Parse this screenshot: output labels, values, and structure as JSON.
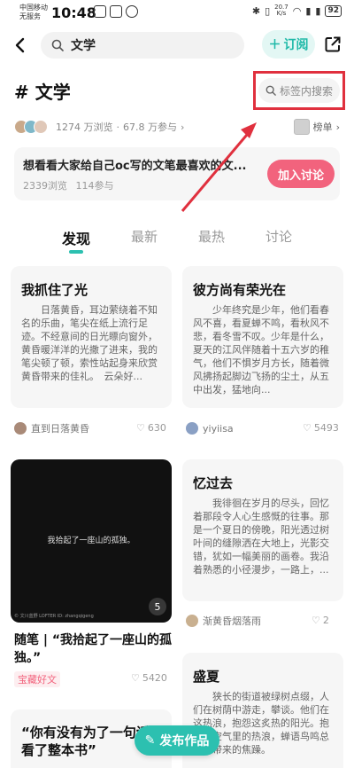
{
  "status_bar": {
    "carrier_line1": "中国移动",
    "carrier_line2": "无服务",
    "time": "10:48",
    "net_speed_value": "20.7",
    "net_speed_unit": "K/s",
    "battery": "92"
  },
  "header": {
    "search_text": "文学",
    "subscribe_label": "订阅"
  },
  "tag": {
    "title": "# 文学",
    "search_placeholder": "标签内搜索",
    "views": "1274 万浏览",
    "participants": "67.8 万参与",
    "rank_label": "榜单"
  },
  "discussion": {
    "title": "想看看大家给自己oc写的文笔最喜欢的文...",
    "views": "2339浏览",
    "participants": "114参与",
    "join_label": "加入讨论"
  },
  "tabs": [
    "发现",
    "最新",
    "最热",
    "讨论"
  ],
  "posts": [
    {
      "title": "我抓住了光",
      "excerpt": "日落黄昏，耳边萦绕着不知名的乐曲，笔尖在纸上流行足迹。不经意间的日光瞟向窗外，黄昏暖洋洋的光撒了进来，我的笔尖顿了顿，索性站起身来欣赏黄昏带来的佳礼。　云朵好...",
      "author": "直到日落黄昏",
      "likes": "630"
    },
    {
      "title": "彼方尚有荣光在",
      "excerpt": "少年终究是少年，他们看春风不喜，看夏蝉不鸣，看秋风不悲，看冬雪不叹。少年是什么，夏天的江风伴随着十五六岁的稚气，他们不惧岁月方长，随着微风拂扬起脚边飞扬的尘土，从五中出发，猛地向...",
      "author": "yiyiisa",
      "likes": "5493"
    },
    {
      "image_text": "我拾起了一座山的孤独。",
      "watermark": "© 文川蓝野 LOFTER ID: zhangqigeng",
      "image_count": "5",
      "title": "随笔 | “我拾起了一座山的孤独。”",
      "badge": "宝藏好文",
      "likes": "5420"
    },
    {
      "title": "忆过去",
      "excerpt": "我徘徊在岁月的尽头，回忆着那段令人心生感慨的往事。那是一个夏日的傍晚，阳光透过树叶间的缝隙洒在大地上，光影交错，犹如一幅美丽的画卷。我沿着熟悉的小径漫步，一路上，...",
      "author": "渐黄昏烟落雨",
      "likes": "2"
    },
    {
      "title": "盛夏",
      "excerpt": "狭长的街道被绿树点缀，人们在树荫中游走，攀谈。他们在这热浪，抱怨这炙热的阳光。抱怨这空气里的热浪，蝉语鸟鸣总给人带来的焦躁。"
    },
    {
      "title": "“你有没有为了一句话，看了整本书”"
    }
  ],
  "publish_label": "发布作品",
  "colors": {
    "accent": "#2cc0b0",
    "join": "#f2637d",
    "highlight": "#e0303e"
  }
}
